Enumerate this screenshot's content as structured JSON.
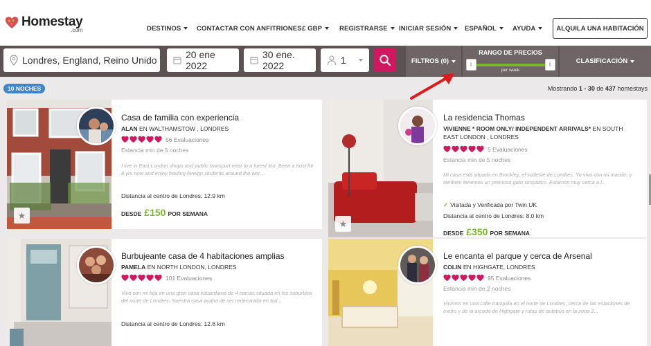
{
  "header": {
    "logo_name": "Homestay",
    "logo_sub": ".com",
    "nav": [
      {
        "label": "DESTINOS",
        "dropdown": true
      },
      {
        "label": "CONTACTAR CON ANFITRIONES",
        "dropdown": false
      },
      {
        "label": "£ GBP",
        "dropdown": true
      },
      {
        "label": "REGISTRARSE",
        "dropdown": true
      },
      {
        "label": "INICIAR SESIÓN",
        "dropdown": true
      },
      {
        "label": "ESPAÑOL",
        "dropdown": true
      },
      {
        "label": "AYUDA",
        "dropdown": true
      }
    ],
    "rent_button": "ALQUILA UNA HABITACIÓN"
  },
  "search": {
    "location": "Londres, England, Reino Unido",
    "checkin": "20 ene 2022",
    "checkout": "30 ene. 2022",
    "guests": "1",
    "filters_label": "FILTROS (0)",
    "price_range_title": "RANGO DE PRECIOS",
    "price_range_unit": "per week",
    "price_slider": {
      "min_fraction": 0.0,
      "max_fraction": 1.0
    },
    "sort_label": "CLASIFICACIÓN"
  },
  "results": {
    "nights_badge": "10 NOCHES",
    "showing_prefix": "Mostrando",
    "showing_range": "1 - 30",
    "showing_of": "de",
    "showing_total": "437",
    "showing_suffix": "homestays"
  },
  "listings": [
    {
      "title": "Casa de familia con experiencia",
      "host_name": "ALAN",
      "host_location": "EN WALTHAMSTOW , LONDRES",
      "rating": 5,
      "reviews": "56 Evaluaciones",
      "min_stay": "Estancia min de 5 noches",
      "description": "I live in East London shops and public transport near to a forest too. Been a host for 8 yrs now and enjoy hosting foreign students around the wor...",
      "distance": "Distancia al centro de Londres: 12.9 km",
      "price_prefix": "DESDE",
      "price": "£150",
      "price_suffix": "POR SEMANA"
    },
    {
      "title": "La residencia Thomas",
      "host_name": "VIVIENNE * ROOM ONLY/ INDEPENDENT ARRIVALS*",
      "host_location": "EN SOUTH EAST LONDON , LONDRES",
      "rating": 5,
      "reviews": "5 Evaluaciones",
      "min_stay": "Estancia min de 5 noches",
      "description": "Mi casa está situada en Brockley, el sudeste de Londres. Yo vivo con mi marido, y también tenemos un precioso gato simpático. Estamos muy cerca a l...",
      "verified": "Visitada y Verificada por Twin UK",
      "distance": "Distancia al centro de Londres: 8.0 km",
      "price_prefix": "DESDE",
      "price": "£350",
      "price_suffix": "POR SEMANA"
    },
    {
      "title": "Burbujeante casa de 4 habitaciones amplias",
      "host_name": "PAMELA",
      "host_location": "EN NORTH LONDON, LONDRES",
      "rating": 5,
      "reviews": "101 Evaluaciones",
      "description": "Vivo con mi hija en una gran casa eduardiana de 4 camas situada en los suburbios del norte de Londres. Nuestra casa acaba de ser redecorada en tod...",
      "distance": "Distancia al centro de Londres: 12.6 km"
    },
    {
      "title": "Le encanta el parque y cerca de Arsenal",
      "host_name": "COLIN",
      "host_location": "EN HIGHGATE, LONDRES",
      "rating": 5,
      "reviews": "95 Evaluaciones",
      "min_stay": "Estancia min de 2 noches",
      "description": "Vivimos en una calle tranquila en el norte de Londres, cerca de las estaciones de metro y de la arcada de Highgate y rutas de autobús en la zona 2..."
    }
  ],
  "colors": {
    "brand_pink": "#d0185e",
    "accent_green": "#76b82a",
    "bar_dark": "#5c5253",
    "badge_blue": "#3f85c7",
    "arrow_red": "#e0191c"
  }
}
